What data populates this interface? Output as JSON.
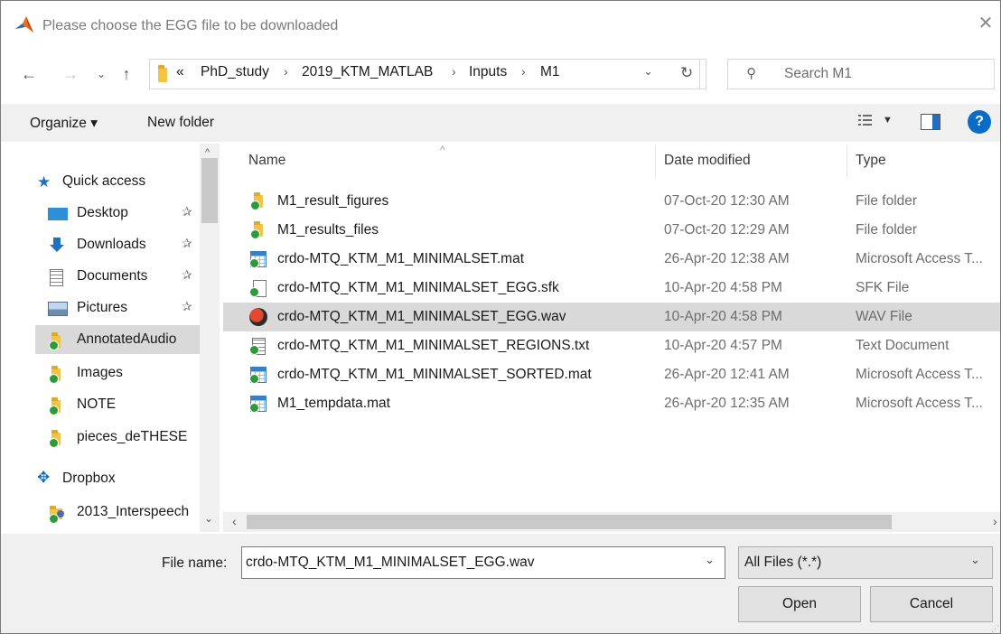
{
  "window": {
    "title": "Please choose the EGG file to be downloaded",
    "close_icon": "close-icon"
  },
  "address": {
    "overflow": "«",
    "crumbs": [
      "PhD_study",
      "2019_KTM_MATLAB",
      "Inputs",
      "M1"
    ],
    "search_placeholder": "Search M1"
  },
  "toolbar": {
    "organize_label": "Organize ▾",
    "new_folder_label": "New folder",
    "help_label": "?"
  },
  "sidebar": {
    "quick_access": "Quick access",
    "items": [
      {
        "label": "Desktop",
        "pinned": true
      },
      {
        "label": "Downloads",
        "pinned": true
      },
      {
        "label": "Documents",
        "pinned": true
      },
      {
        "label": "Pictures",
        "pinned": true
      },
      {
        "label": "AnnotatedAudio",
        "pinned": false
      },
      {
        "label": "Images",
        "pinned": false
      },
      {
        "label": "NOTE",
        "pinned": false
      },
      {
        "label": "pieces_deTHESE",
        "pinned": false
      }
    ],
    "dropbox": "Dropbox",
    "dropbox_item": "2013_Interspeech"
  },
  "file_list": {
    "columns": [
      "Name",
      "Date modified",
      "Type"
    ],
    "rows": [
      {
        "name": "M1_result_figures",
        "date": "07-Oct-20 12:30 AM",
        "type": "File folder",
        "icon": "folder-icon"
      },
      {
        "name": "M1_results_files",
        "date": "07-Oct-20 12:29 AM",
        "type": "File folder",
        "icon": "folder-icon"
      },
      {
        "name": "crdo-MTQ_KTM_M1_MINIMALSET.mat",
        "date": "26-Apr-20 12:38 AM",
        "type": "Microsoft Access T...",
        "icon": "table-file-icon"
      },
      {
        "name": "crdo-MTQ_KTM_M1_MINIMALSET_EGG.sfk",
        "date": "10-Apr-20 4:58 PM",
        "type": "SFK File",
        "icon": "generic-file-icon"
      },
      {
        "name": "crdo-MTQ_KTM_M1_MINIMALSET_EGG.wav",
        "date": "10-Apr-20 4:58 PM",
        "type": "WAV File",
        "icon": "audio-file-icon"
      },
      {
        "name": "crdo-MTQ_KTM_M1_MINIMALSET_REGIONS.txt",
        "date": "10-Apr-20 4:57 PM",
        "type": "Text Document",
        "icon": "text-file-icon"
      },
      {
        "name": "crdo-MTQ_KTM_M1_MINIMALSET_SORTED.mat",
        "date": "26-Apr-20 12:41 AM",
        "type": "Microsoft Access T...",
        "icon": "table-file-icon"
      },
      {
        "name": "M1_tempdata.mat",
        "date": "26-Apr-20 12:35 AM",
        "type": "Microsoft Access T...",
        "icon": "table-file-icon"
      }
    ],
    "selected_index": 4
  },
  "footer": {
    "filename_label": "File name:",
    "filename_value": "crdo-MTQ_KTM_M1_MINIMALSET_EGG.wav",
    "filter_value": "All Files (*.*)",
    "open_label": "Open",
    "cancel_label": "Cancel"
  },
  "colors": {
    "selection": "#d9d9d9",
    "chrome": "#f0f0f0",
    "accent": "#0b6cc8"
  }
}
